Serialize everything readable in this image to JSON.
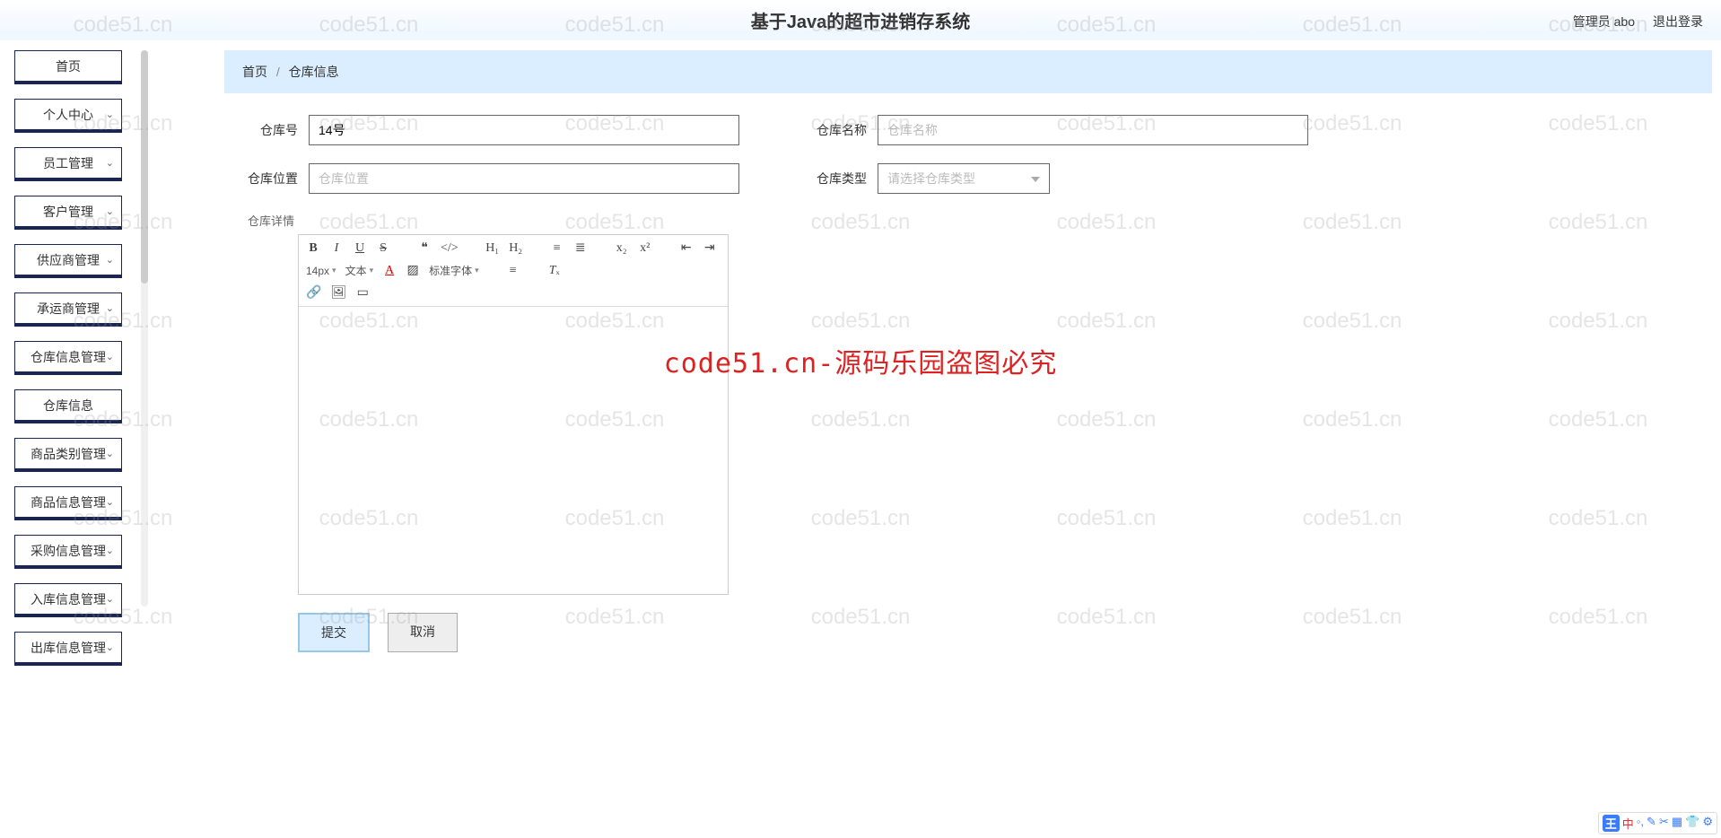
{
  "header": {
    "title": "基于Java的超市进销存系统",
    "user_label": "管理员 abo",
    "logout": "退出登录"
  },
  "sidebar": {
    "items": [
      {
        "label": "首页",
        "expandable": false
      },
      {
        "label": "个人中心",
        "expandable": true
      },
      {
        "label": "员工管理",
        "expandable": true
      },
      {
        "label": "客户管理",
        "expandable": true
      },
      {
        "label": "供应商管理",
        "expandable": true
      },
      {
        "label": "承运商管理",
        "expandable": true
      },
      {
        "label": "仓库信息管理",
        "expandable": true
      },
      {
        "label": "仓库信息",
        "expandable": false,
        "sub": true
      },
      {
        "label": "商品类别管理",
        "expandable": true
      },
      {
        "label": "商品信息管理",
        "expandable": true
      },
      {
        "label": "采购信息管理",
        "expandable": true
      },
      {
        "label": "入库信息管理",
        "expandable": true
      },
      {
        "label": "出库信息管理",
        "expandable": true
      }
    ]
  },
  "breadcrumb": {
    "home": "首页",
    "current": "仓库信息"
  },
  "form": {
    "field_no": {
      "label": "仓库号",
      "value": "14号"
    },
    "field_name": {
      "label": "仓库名称",
      "placeholder": "仓库名称"
    },
    "field_loc": {
      "label": "仓库位置",
      "placeholder": "仓库位置"
    },
    "field_type": {
      "label": "仓库类型",
      "placeholder": "请选择仓库类型"
    },
    "field_detail": {
      "label": "仓库详情"
    },
    "submit": "提交",
    "cancel": "取消"
  },
  "editor": {
    "font_size": "14px",
    "text_label": "文本",
    "font_family": "标准字体"
  },
  "watermark": {
    "repeat_text": "code51.cn",
    "center_text": "code51.cn-源码乐园盗图必究"
  }
}
